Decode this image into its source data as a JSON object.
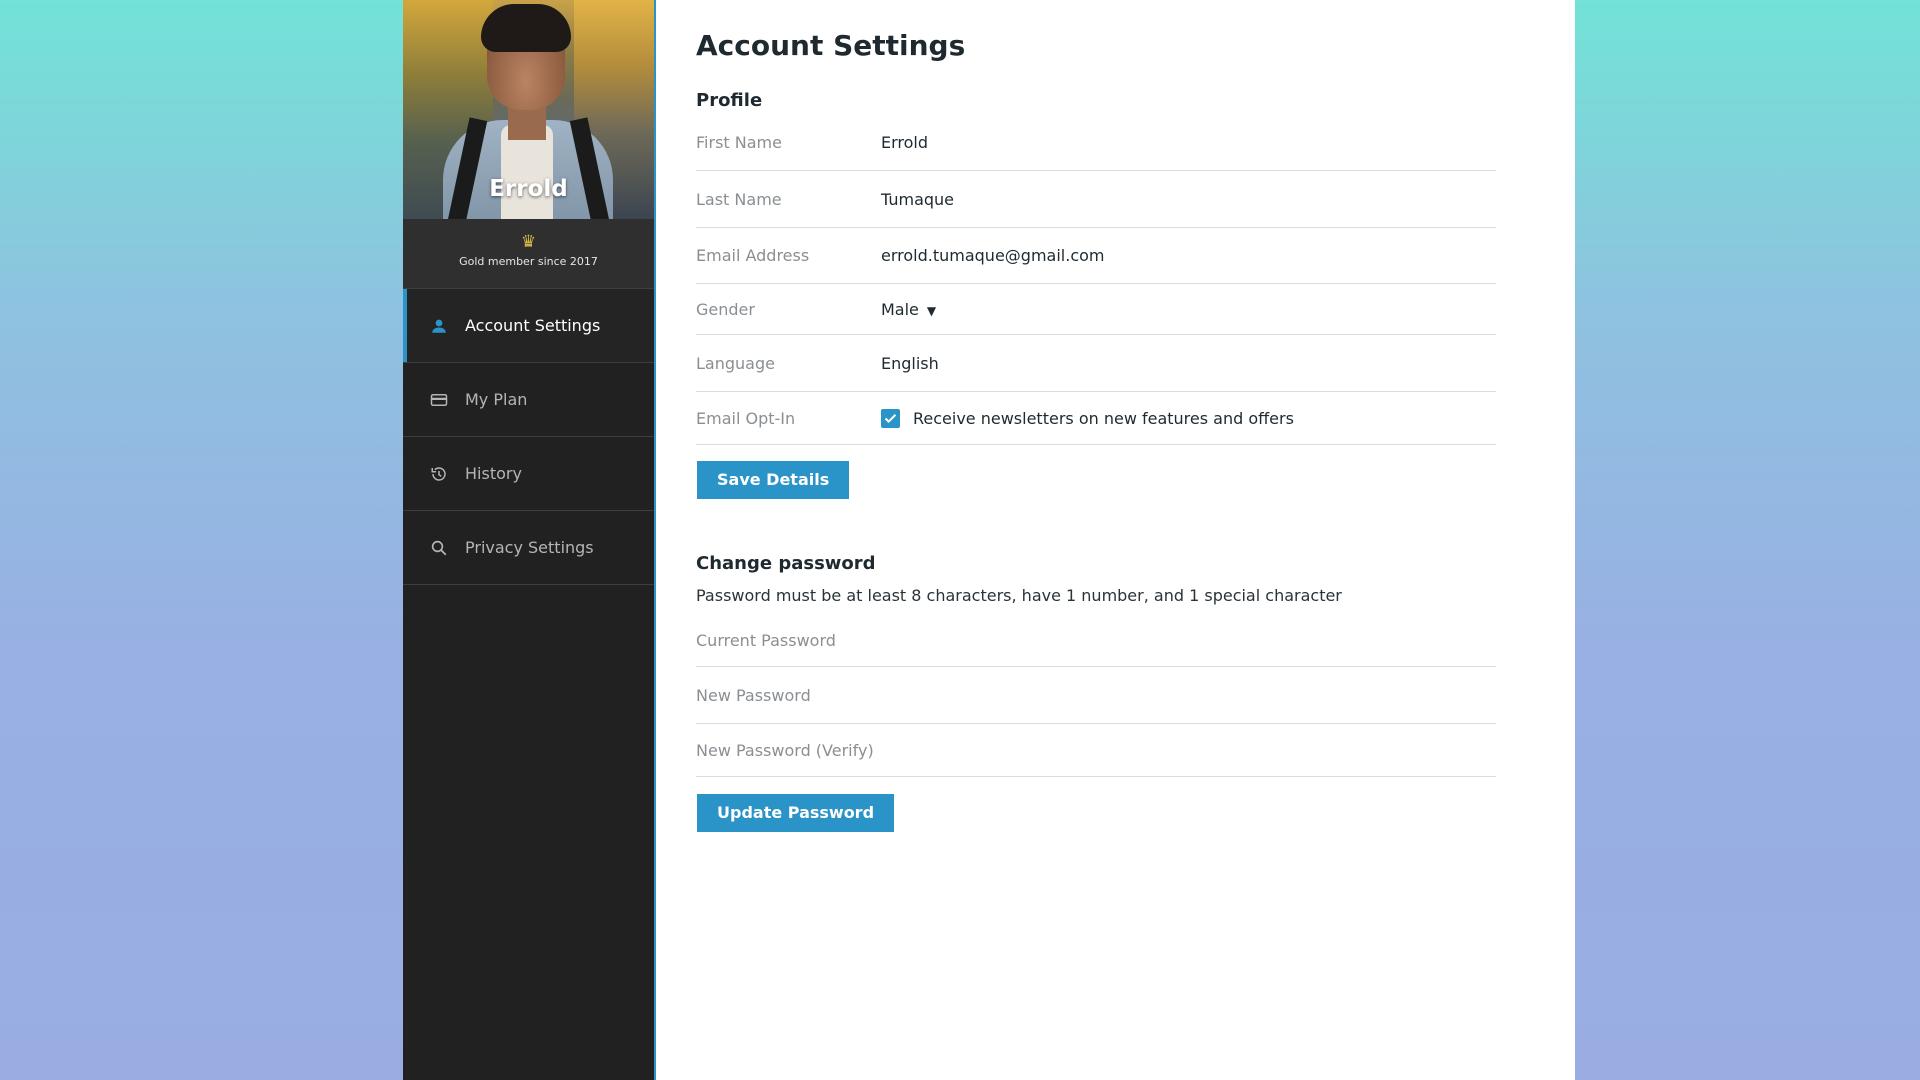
{
  "sidebar": {
    "user_name": "Errold",
    "membership": "Gold member since 2017",
    "items": [
      {
        "label": "Account Settings",
        "icon": "person-icon",
        "active": true
      },
      {
        "label": "My Plan",
        "icon": "credit-card-icon",
        "active": false
      },
      {
        "label": "History",
        "icon": "history-icon",
        "active": false
      },
      {
        "label": "Privacy Settings",
        "icon": "search-icon",
        "active": false
      }
    ]
  },
  "main": {
    "title": "Account Settings",
    "profile": {
      "title": "Profile",
      "fields": {
        "first_name": {
          "label": "First Name",
          "value": "Errold"
        },
        "last_name": {
          "label": "Last Name",
          "value": "Tumaque"
        },
        "email": {
          "label": "Email Address",
          "value": "errold.tumaque@gmail.com"
        },
        "gender": {
          "label": "Gender",
          "value": "Male"
        },
        "language": {
          "label": "Language",
          "value": "English"
        },
        "opt_in": {
          "label": "Email Opt-In",
          "value": "Receive newsletters on new features and offers",
          "checked": true
        }
      },
      "save_label": "Save Details"
    },
    "password": {
      "title": "Change password",
      "hint": "Password must be at least 8 characters, have 1 number, and 1 special character",
      "current_placeholder": "Current Password",
      "new_placeholder": "New Password",
      "verify_placeholder": "New Password (Verify)",
      "update_label": "Update Password"
    }
  },
  "colors": {
    "accent": "#2a94c8",
    "sidebar_bg": "#212121",
    "crown": "#d8b94a"
  }
}
